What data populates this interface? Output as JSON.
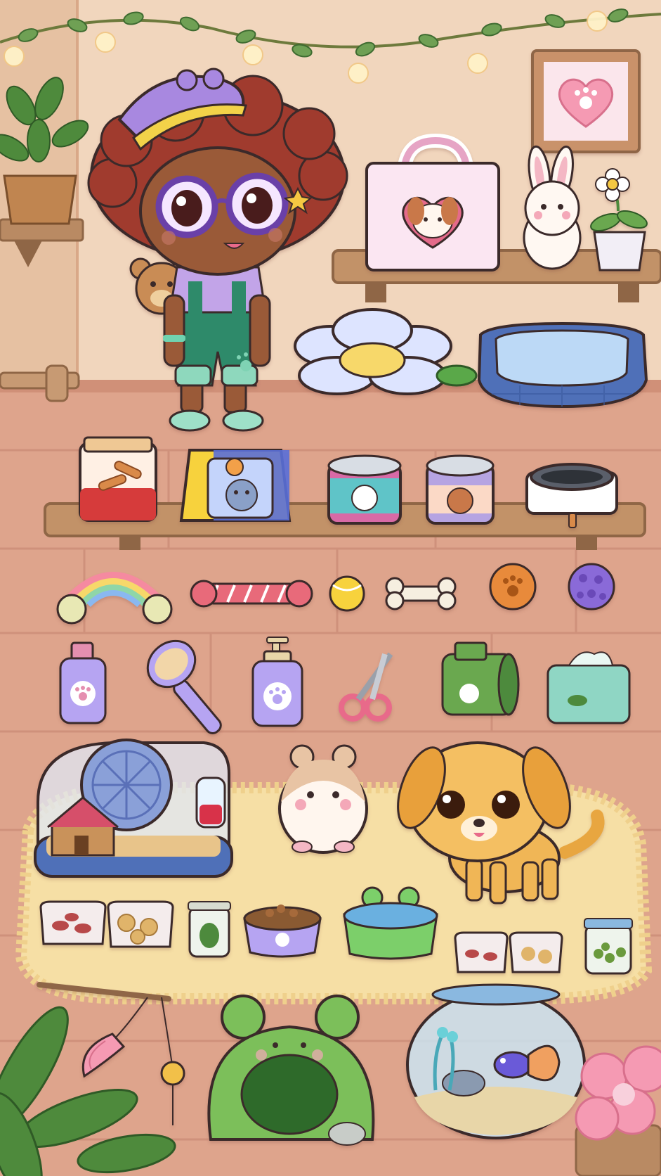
{
  "scene": {
    "title": "",
    "palette": {
      "wall": "#f1d6bd",
      "wall_dark": "#e8c4a6",
      "floor": "#dea48c",
      "floor_line": "#c98a74",
      "shelf": "#b98a63",
      "shelf_dark": "#8f6646",
      "rug": "#f6dfa5",
      "rug_fringe": "#efd08c",
      "outline": "#3a2a2a",
      "sticker_border": "#ffffff"
    }
  },
  "decor": {
    "lights": "string-lights-with-paw-bulbs",
    "wall_frame": "paw-heart-picture-frame",
    "plants": [
      "hanging-potted-plant",
      "corner-leaves",
      "pink-flower"
    ]
  },
  "character": {
    "name": "girl-with-glasses-and-cap",
    "accessory": "teddy-bear-backpack"
  },
  "items": {
    "top_shelf": [
      "pet-carrier-bag",
      "bunny-plush",
      "flower-pot"
    ],
    "beds": [
      "flower-pet-bed",
      "blue-pet-bed"
    ],
    "food_shelf": [
      "dog-treat-jar",
      "cat-food-bag",
      "cat-food-can",
      "dog-food-can",
      "raised-pet-bowl"
    ],
    "toys": [
      "rainbow-yarn-toy",
      "rope-toy",
      "tennis-ball",
      "bone-toy",
      "orange-paw-ball",
      "spiky-ball"
    ],
    "grooming": [
      "paw-bottle",
      "pet-brush",
      "pump-shampoo",
      "nail-clippers",
      "poop-bag-roll",
      "wipes-box"
    ],
    "pets": [
      "hamster",
      "golden-puppy",
      "betta-fish"
    ],
    "habitat": [
      "hamster-cage-with-wheel",
      "fish-bowl",
      "frog-pet-cave"
    ],
    "snacks": [
      "dried-fruit-bag",
      "cookie-bag",
      "veggie-jar",
      "kibble-bowl",
      "frog-water-bowl",
      "small-snack-bag-1",
      "small-snack-bag-2",
      "green-pellet-jar"
    ],
    "wand": "feather-wand-toy"
  }
}
